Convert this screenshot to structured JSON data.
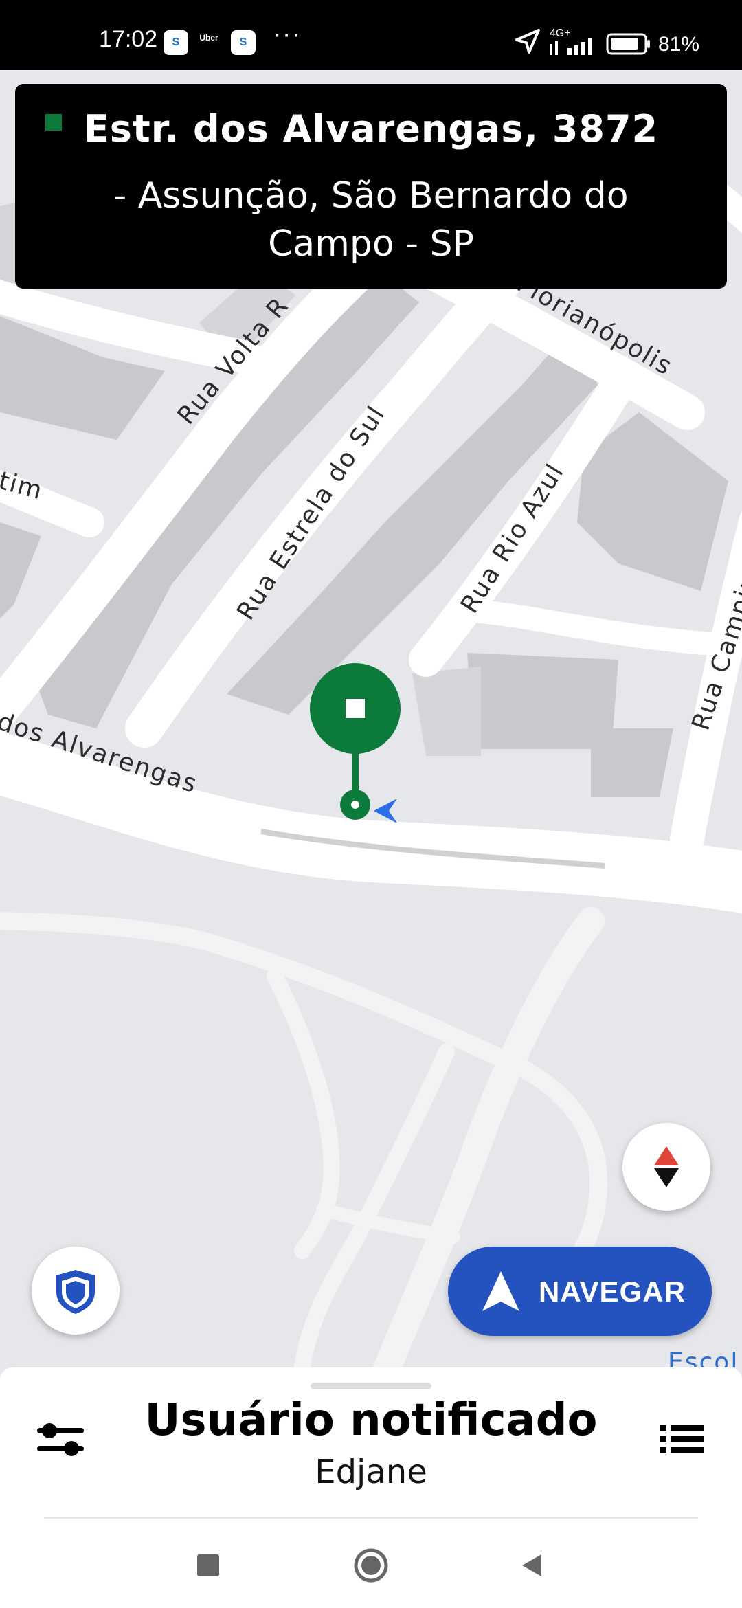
{
  "status_bar": {
    "time": "17:02",
    "notification_icons": [
      "S",
      "Uber",
      "S"
    ],
    "more_indicator": "···",
    "network": "4G+",
    "battery_percent": "81%"
  },
  "address_banner": {
    "line1": "Estr. dos Alvarengas, 3872",
    "line2": "- Assunção, São Bernardo do Campo - SP",
    "marker_color": "#0b7a3a"
  },
  "map": {
    "streets": {
      "volta": "Rua Volta R",
      "florianopolis": "Florianópolis",
      "estrela": "Rua Estrela do Sul",
      "rio_azul": "Rua Rio Azul",
      "campina": "Rua Campin",
      "timbo": "tim",
      "alvarengas": "dos Alvarengas",
      "escola": "Escol"
    },
    "pin_color": "#0b7a3a",
    "location_color": "#2a6fe8"
  },
  "buttons": {
    "navigate_label": "NAVEGAR"
  },
  "bottom_sheet": {
    "title": "Usuário notificado",
    "subtitle": "Edjane"
  },
  "colors": {
    "accent_blue": "#2452be",
    "compass_red": "#e0453a"
  }
}
